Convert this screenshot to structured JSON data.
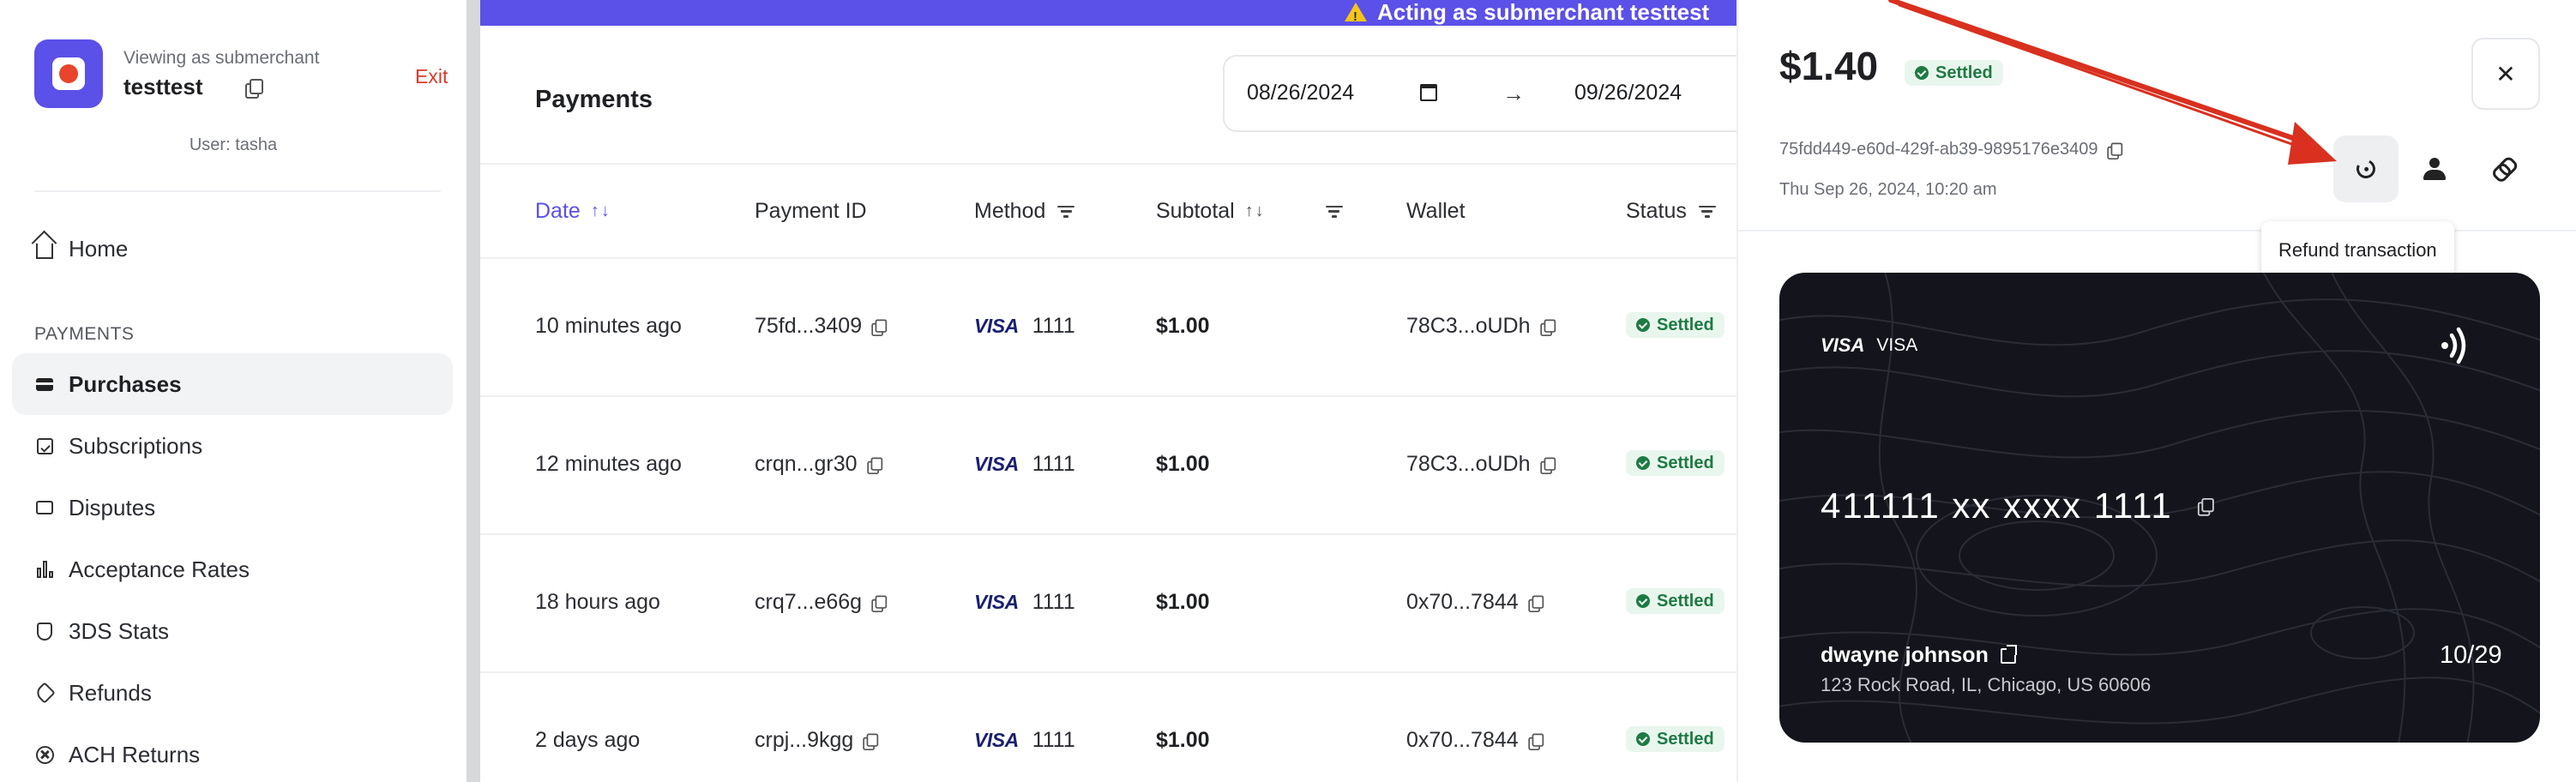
{
  "sidebar": {
    "viewing_label": "Viewing as submerchant",
    "merchant_name": "testtest",
    "exit_label": "Exit",
    "user_line": "User: tasha",
    "home_label": "Home",
    "section_label": "PAYMENTS",
    "items": [
      {
        "label": "Purchases",
        "icon": "card-icon",
        "active": true
      },
      {
        "label": "Subscriptions",
        "icon": "calendar-check-icon"
      },
      {
        "label": "Disputes",
        "icon": "chat-icon"
      },
      {
        "label": "Acceptance Rates",
        "icon": "bar-chart-icon"
      },
      {
        "label": "3DS Stats",
        "icon": "shield-icon"
      },
      {
        "label": "Refunds",
        "icon": "tag-icon"
      },
      {
        "label": "ACH Returns",
        "icon": "x-circle-icon"
      }
    ]
  },
  "banner": {
    "text": "Acting as submerchant testtest",
    "color": "#5b50e8"
  },
  "main": {
    "title": "Payments",
    "date_from": "08/26/2024",
    "date_to": "09/26/2024",
    "columns": [
      "Date",
      "Payment ID",
      "Method",
      "Subtotal",
      "Wallet",
      "Status"
    ],
    "rows": [
      {
        "date": "10 minutes ago",
        "payment_id": "75fd...3409",
        "brand": "VISA",
        "last4": "1111",
        "subtotal": "$1.00",
        "wallet": "78C3...oUDh",
        "status": "Settled"
      },
      {
        "date": "12 minutes ago",
        "payment_id": "crqn...gr30",
        "brand": "VISA",
        "last4": "1111",
        "subtotal": "$1.00",
        "wallet": "78C3...oUDh",
        "status": "Settled"
      },
      {
        "date": "18 hours ago",
        "payment_id": "crq7...e66g",
        "brand": "VISA",
        "last4": "1111",
        "subtotal": "$1.00",
        "wallet": "0x70...7844",
        "status": "Settled"
      },
      {
        "date": "2 days ago",
        "payment_id": "crpj...9kgg",
        "brand": "VISA",
        "last4": "1111",
        "subtotal": "$1.00",
        "wallet": "0x70...7844",
        "status": "Settled"
      }
    ]
  },
  "detail": {
    "amount": "$1.40",
    "status": "Settled",
    "transaction_id": "75fdd449-e60d-429f-ab39-9895176e3409",
    "date": "Thu Sep 26, 2024, 10:20 am",
    "tooltip": "Refund transaction",
    "card": {
      "brand_logo": "VISA",
      "brand_text": "VISA",
      "number": "411111 xx xxxx 1111",
      "holder": "dwayne johnson",
      "address": "123 Rock Road, IL, Chicago, US 60606",
      "expiry": "10/29"
    }
  },
  "colors": {
    "accent": "#5b50e8",
    "settled_bg": "#e9f6ee",
    "settled_fg": "#1e7a43",
    "exit": "#d93a2b",
    "annotation_arrow": "#d9301f"
  }
}
